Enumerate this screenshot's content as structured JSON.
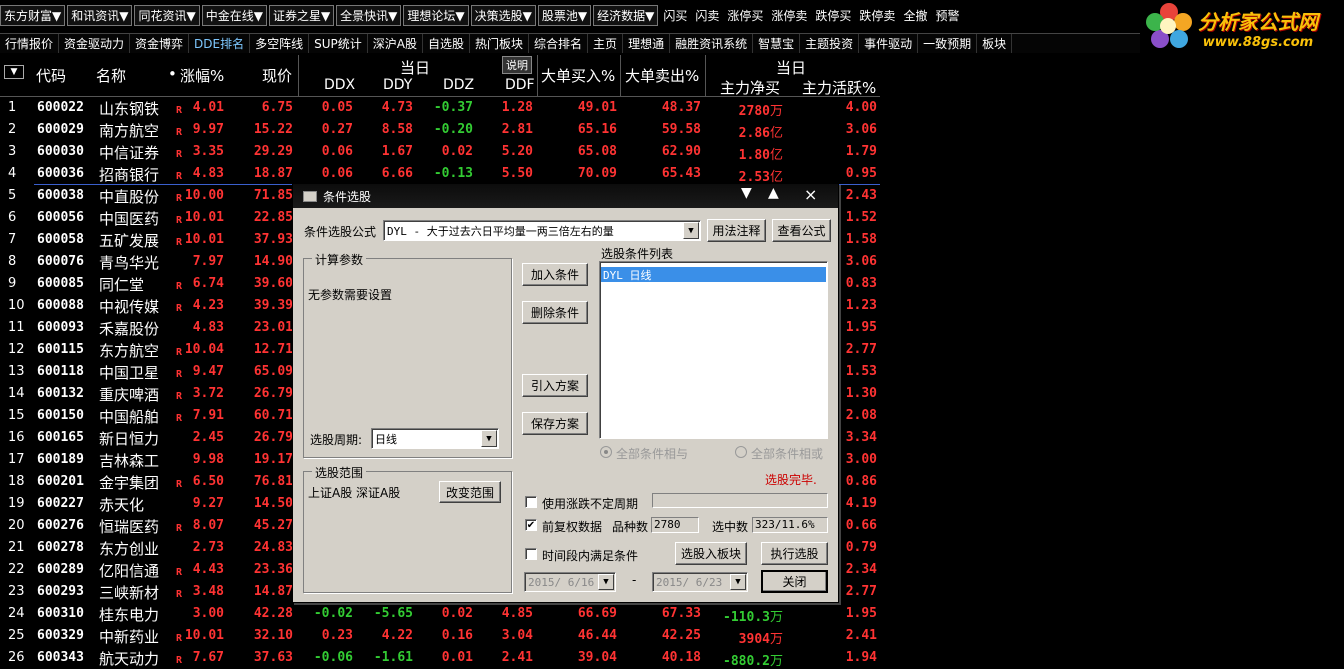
{
  "menubar": {
    "items": [
      "东方财富▼",
      "和讯资讯▼",
      "同花资讯▼",
      "中金在线▼",
      "证券之星▼",
      "全景快讯▼",
      "理想论坛▼",
      "决策选股▼",
      "股票池▼",
      "经济数据▼",
      "闪买",
      "闪卖",
      "涨停买",
      "涨停卖",
      "跌停买",
      "跌停卖",
      "全撤",
      "预警"
    ]
  },
  "tabbar": {
    "tabs": [
      "行情报价",
      "资金驱动力",
      "资金博弈",
      "DDE排名",
      "多空阵线",
      "SUP统计",
      "深沪A股",
      "自选股",
      "热门板块",
      "综合排名",
      "主页",
      "理想通",
      "融胜资讯系统",
      "智慧宝",
      "主题投资",
      "事件驱动",
      "一致预期",
      "板块"
    ]
  },
  "logo": {
    "title": "分析家公式网",
    "url": "www.88gs.com"
  },
  "header": {
    "menu_icon": "▼",
    "code": "代码",
    "name": "名称",
    "dot": "•",
    "pct": "涨幅%",
    "price": "现价",
    "group1": "当日",
    "explain": "说明",
    "ddx": "DDX",
    "ddy": "DDY",
    "ddz": "DDZ",
    "ddf": "DDF",
    "big_buy": "大单买入%",
    "big_sell": "大单卖出%",
    "group2": "当日",
    "net": "主力净买",
    "active": "主力活跃%"
  },
  "rows": [
    {
      "n": "1",
      "code": "600022",
      "name": "山东钢铁",
      "r": "R",
      "pct": "4.01",
      "price": "6.75",
      "ddx": "0.05",
      "ddy": "4.73",
      "ddz": "-0.37",
      "ddf": "1.28",
      "buy": "49.01",
      "sell": "48.37",
      "net": "2780",
      "unit": "万",
      "act": "4.00"
    },
    {
      "n": "2",
      "code": "600029",
      "name": "南方航空",
      "r": "R",
      "pct": "9.97",
      "price": "15.22",
      "ddx": "0.27",
      "ddy": "8.58",
      "ddz": "-0.20",
      "ddf": "2.81",
      "buy": "65.16",
      "sell": "59.58",
      "net": "2.86",
      "unit": "亿",
      "act": "3.06"
    },
    {
      "n": "3",
      "code": "600030",
      "name": "中信证券",
      "r": "R",
      "pct": "3.35",
      "price": "29.29",
      "ddx": "0.06",
      "ddy": "1.67",
      "ddz": "0.02",
      "ddf": "5.20",
      "buy": "65.08",
      "sell": "62.90",
      "net": "1.80",
      "unit": "亿",
      "act": "1.79"
    },
    {
      "n": "4",
      "code": "600036",
      "name": "招商银行",
      "r": "R",
      "pct": "4.83",
      "price": "18.87",
      "ddx": "0.06",
      "ddy": "6.66",
      "ddz": "-0.13",
      "ddf": "5.50",
      "buy": "70.09",
      "sell": "65.43",
      "net": "2.53",
      "unit": "亿",
      "act": "0.95"
    },
    {
      "n": "5",
      "code": "600038",
      "name": "中直股份",
      "r": "R",
      "pct": "10.00",
      "price": "71.85",
      "ddx": "",
      "ddy": "",
      "ddz": "",
      "ddf": "",
      "buy": "",
      "sell": "",
      "net": "",
      "unit": "",
      "act": "2.43"
    },
    {
      "n": "6",
      "code": "600056",
      "name": "中国医药",
      "r": "R",
      "pct": "10.01",
      "price": "22.85",
      "ddx": "",
      "ddy": "",
      "ddz": "",
      "ddf": "",
      "buy": "",
      "sell": "",
      "net": "",
      "unit": "",
      "act": "1.52"
    },
    {
      "n": "7",
      "code": "600058",
      "name": "五矿发展",
      "r": "R",
      "pct": "10.01",
      "price": "37.93",
      "ddx": "",
      "ddy": "",
      "ddz": "",
      "ddf": "",
      "buy": "",
      "sell": "",
      "net": "",
      "unit": "",
      "act": "1.58"
    },
    {
      "n": "8",
      "code": "600076",
      "name": "青鸟华光",
      "r": "",
      "pct": "7.97",
      "price": "14.90",
      "ddx": "",
      "ddy": "",
      "ddz": "",
      "ddf": "",
      "buy": "",
      "sell": "",
      "net": "",
      "unit": "",
      "act": "3.06"
    },
    {
      "n": "9",
      "code": "600085",
      "name": "同仁堂",
      "r": "R",
      "pct": "6.74",
      "price": "39.60",
      "ddx": "",
      "ddy": "",
      "ddz": "",
      "ddf": "",
      "buy": "",
      "sell": "",
      "net": "",
      "unit": "",
      "act": "0.83"
    },
    {
      "n": "10",
      "code": "600088",
      "name": "中视传媒",
      "r": "R",
      "pct": "4.23",
      "price": "39.39",
      "ddx": "",
      "ddy": "",
      "ddz": "",
      "ddf": "",
      "buy": "",
      "sell": "",
      "net": "",
      "unit": "",
      "act": "1.23"
    },
    {
      "n": "11",
      "code": "600093",
      "name": "禾嘉股份",
      "r": "",
      "pct": "4.83",
      "price": "23.01",
      "ddx": "",
      "ddy": "",
      "ddz": "",
      "ddf": "",
      "buy": "",
      "sell": "",
      "net": "",
      "unit": "",
      "act": "1.95"
    },
    {
      "n": "12",
      "code": "600115",
      "name": "东方航空",
      "r": "R",
      "pct": "10.04",
      "price": "12.71",
      "ddx": "",
      "ddy": "",
      "ddz": "",
      "ddf": "",
      "buy": "",
      "sell": "",
      "net": "",
      "unit": "",
      "act": "2.77"
    },
    {
      "n": "13",
      "code": "600118",
      "name": "中国卫星",
      "r": "R",
      "pct": "9.47",
      "price": "65.09",
      "ddx": "",
      "ddy": "",
      "ddz": "",
      "ddf": "",
      "buy": "",
      "sell": "",
      "net": "",
      "unit": "",
      "act": "1.53"
    },
    {
      "n": "14",
      "code": "600132",
      "name": "重庆啤酒",
      "r": "R",
      "pct": "3.72",
      "price": "26.79",
      "ddx": "",
      "ddy": "",
      "ddz": "",
      "ddf": "",
      "buy": "",
      "sell": "",
      "net": "",
      "unit": "",
      "act": "1.30"
    },
    {
      "n": "15",
      "code": "600150",
      "name": "中国船舶",
      "r": "R",
      "pct": "7.91",
      "price": "60.71",
      "ddx": "",
      "ddy": "",
      "ddz": "",
      "ddf": "",
      "buy": "",
      "sell": "",
      "net": "",
      "unit": "",
      "act": "2.08"
    },
    {
      "n": "16",
      "code": "600165",
      "name": "新日恒力",
      "r": "",
      "pct": "2.45",
      "price": "26.79",
      "ddx": "",
      "ddy": "",
      "ddz": "",
      "ddf": "",
      "buy": "",
      "sell": "",
      "net": "",
      "unit": "",
      "act": "3.34"
    },
    {
      "n": "17",
      "code": "600189",
      "name": "吉林森工",
      "r": "",
      "pct": "9.98",
      "price": "19.17",
      "ddx": "",
      "ddy": "",
      "ddz": "",
      "ddf": "",
      "buy": "",
      "sell": "",
      "net": "",
      "unit": "",
      "act": "3.00"
    },
    {
      "n": "18",
      "code": "600201",
      "name": "金宇集团",
      "r": "R",
      "pct": "6.50",
      "price": "76.81",
      "ddx": "",
      "ddy": "",
      "ddz": "",
      "ddf": "",
      "buy": "",
      "sell": "",
      "net": "",
      "unit": "",
      "act": "0.86"
    },
    {
      "n": "19",
      "code": "600227",
      "name": "赤天化",
      "r": "",
      "pct": "9.27",
      "price": "14.50",
      "ddx": "",
      "ddy": "",
      "ddz": "",
      "ddf": "",
      "buy": "",
      "sell": "",
      "net": "",
      "unit": "",
      "act": "4.19"
    },
    {
      "n": "20",
      "code": "600276",
      "name": "恒瑞医药",
      "r": "R",
      "pct": "8.07",
      "price": "45.27",
      "ddx": "",
      "ddy": "",
      "ddz": "",
      "ddf": "",
      "buy": "",
      "sell": "",
      "net": "",
      "unit": "",
      "act": "0.66"
    },
    {
      "n": "21",
      "code": "600278",
      "name": "东方创业",
      "r": "",
      "pct": "2.73",
      "price": "24.83",
      "ddx": "",
      "ddy": "",
      "ddz": "",
      "ddf": "",
      "buy": "",
      "sell": "",
      "net": "",
      "unit": "",
      "act": "0.79"
    },
    {
      "n": "22",
      "code": "600289",
      "name": "亿阳信通",
      "r": "R",
      "pct": "4.43",
      "price": "23.36",
      "ddx": "",
      "ddy": "",
      "ddz": "",
      "ddf": "",
      "buy": "",
      "sell": "",
      "net": "",
      "unit": "",
      "act": "2.34"
    },
    {
      "n": "23",
      "code": "600293",
      "name": "三峡新材",
      "r": "R",
      "pct": "3.48",
      "price": "14.87",
      "ddx": "",
      "ddy": "",
      "ddz": "",
      "ddf": "",
      "buy": "",
      "sell": "",
      "net": "",
      "unit": "",
      "act": "2.77"
    },
    {
      "n": "24",
      "code": "600310",
      "name": "桂东电力",
      "r": "",
      "pct": "3.00",
      "price": "42.28",
      "ddx": "-0.02",
      "ddy": "-5.65",
      "ddz": "0.02",
      "ddf": "4.85",
      "buy": "66.69",
      "sell": "67.33",
      "net": "-110.3",
      "unit": "万",
      "act": "1.95"
    },
    {
      "n": "25",
      "code": "600329",
      "name": "中新药业",
      "r": "R",
      "pct": "10.01",
      "price": "32.10",
      "ddx": "0.23",
      "ddy": "4.22",
      "ddz": "0.16",
      "ddf": "3.04",
      "buy": "46.44",
      "sell": "42.25",
      "net": "3904",
      "unit": "万",
      "act": "2.41"
    },
    {
      "n": "26",
      "code": "600343",
      "name": "航天动力",
      "r": "R",
      "pct": "7.67",
      "price": "37.63",
      "ddx": "-0.06",
      "ddy": "-1.61",
      "ddz": "0.01",
      "ddf": "2.41",
      "buy": "39.04",
      "sell": "40.18",
      "net": "-880.2",
      "unit": "万",
      "act": "1.94"
    }
  ],
  "dialog": {
    "title": "条件选股",
    "ctrl_down": "▼",
    "ctrl_up": "▲",
    "ctrl_close": "×",
    "formula_label": "条件选股公式",
    "formula_value": "DYL       - 大于过去六日平均量一两三倍左右的量",
    "usage_btn": "用法注释",
    "view_btn": "查看公式",
    "params_group": "计算参数",
    "no_params": "无参数需要设置",
    "period_label": "选股周期:",
    "period_value": "日线",
    "list_label": "选股条件列表",
    "list_items": [
      "DYL  日线"
    ],
    "add_btn": "加入条件",
    "del_btn": "删除条件",
    "import_btn": "引入方案",
    "save_btn": "保存方案",
    "and_label": "全部条件相与",
    "or_label": "全部条件相或",
    "done_text": "选股完毕.",
    "range_group": "选股范围",
    "range_value": "上证A股  深证A股",
    "change_range_btn": "改变范围",
    "use_zd_label": "使用涨跌不定周期",
    "use_zd_checked": false,
    "fuquan_label": "前复权数据",
    "fuquan_checked": true,
    "count_label": "品种数",
    "count_value": "2780",
    "selected_label": "选中数",
    "selected_value": "323/11.6%",
    "period_range_label": "时间段内满足条件",
    "to_block_btn": "选股入板块",
    "execute_btn": "执行选股",
    "date_from": "2015/ 6/16",
    "date_dash": "-",
    "date_to": "2015/ 6/23",
    "close_btn": "关闭"
  },
  "colors": {
    "up": "#ff3333",
    "down": "#33cc33",
    "bg": "#000000",
    "dialog_bg": "#d4d0c8",
    "done": "#cc0000"
  }
}
